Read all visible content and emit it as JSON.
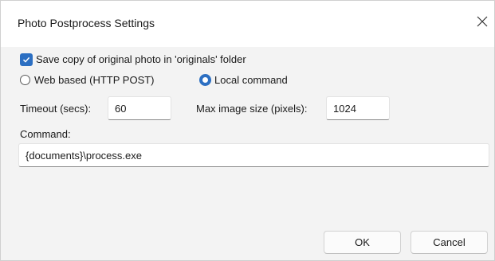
{
  "dialog": {
    "title": "Photo Postprocess Settings",
    "close_icon": "close-icon"
  },
  "save_copy": {
    "label": "Save copy of original photo in 'originals' folder",
    "checked": true
  },
  "mode": {
    "web_label": "Web based (HTTP POST)",
    "local_label": "Local command",
    "selected": "Local command"
  },
  "timeout": {
    "label": "Timeout (secs):",
    "value": "60"
  },
  "max_size": {
    "label": "Max image size (pixels):",
    "value": "1024"
  },
  "command": {
    "label": "Command:",
    "value": "{documents}\\process.exe"
  },
  "buttons": {
    "ok": "OK",
    "cancel": "Cancel"
  },
  "colors": {
    "accent": "#2c6fc2",
    "background": "#f3f3f3"
  }
}
